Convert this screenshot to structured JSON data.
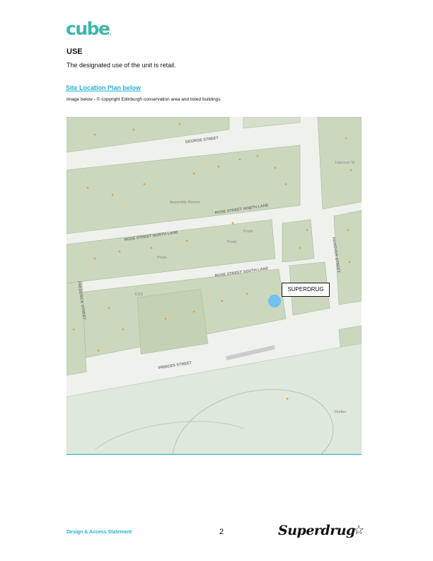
{
  "header": {
    "logo_text": "cube",
    "logo_dot": "."
  },
  "section": {
    "heading": "USE",
    "body": "The designated use of the unit is retail.",
    "link_text": "Site Location Plan below",
    "image_caption": "Image below - © copyright Edinburgh conservation area and listed buildings"
  },
  "map": {
    "streets": {
      "george": "GEORGE STREET",
      "rose_north": "ROSE STREET NORTH LANE",
      "rose_north_2": "ROSE STREET NORTH LANE",
      "rose_south": "ROSE STREET SOUTH LANE",
      "princes": "PRINCES STREET",
      "hanover": "HANOVER STREET",
      "frederick": "FREDERICK STREET"
    },
    "places": {
      "assembly": "Assembly Rooms",
      "posts1": "Posts",
      "posts2": "Posts",
      "posts3": "Posts",
      "ess": "ESS",
      "shelter": "Shelter",
      "hanover_mews": "Hanover M"
    },
    "label": "SUPERDRUG",
    "colors": {
      "block": "#cbd8bd",
      "street": "#f3f5f1",
      "park": "#dfe8dc",
      "dot": "#e3a24e",
      "marker": "#6fc1ef"
    }
  },
  "footer": {
    "left_text": "Design & Access Statement",
    "page_number": "2",
    "brand": "Superdrug",
    "brand_icon": "star-outline-icon"
  }
}
